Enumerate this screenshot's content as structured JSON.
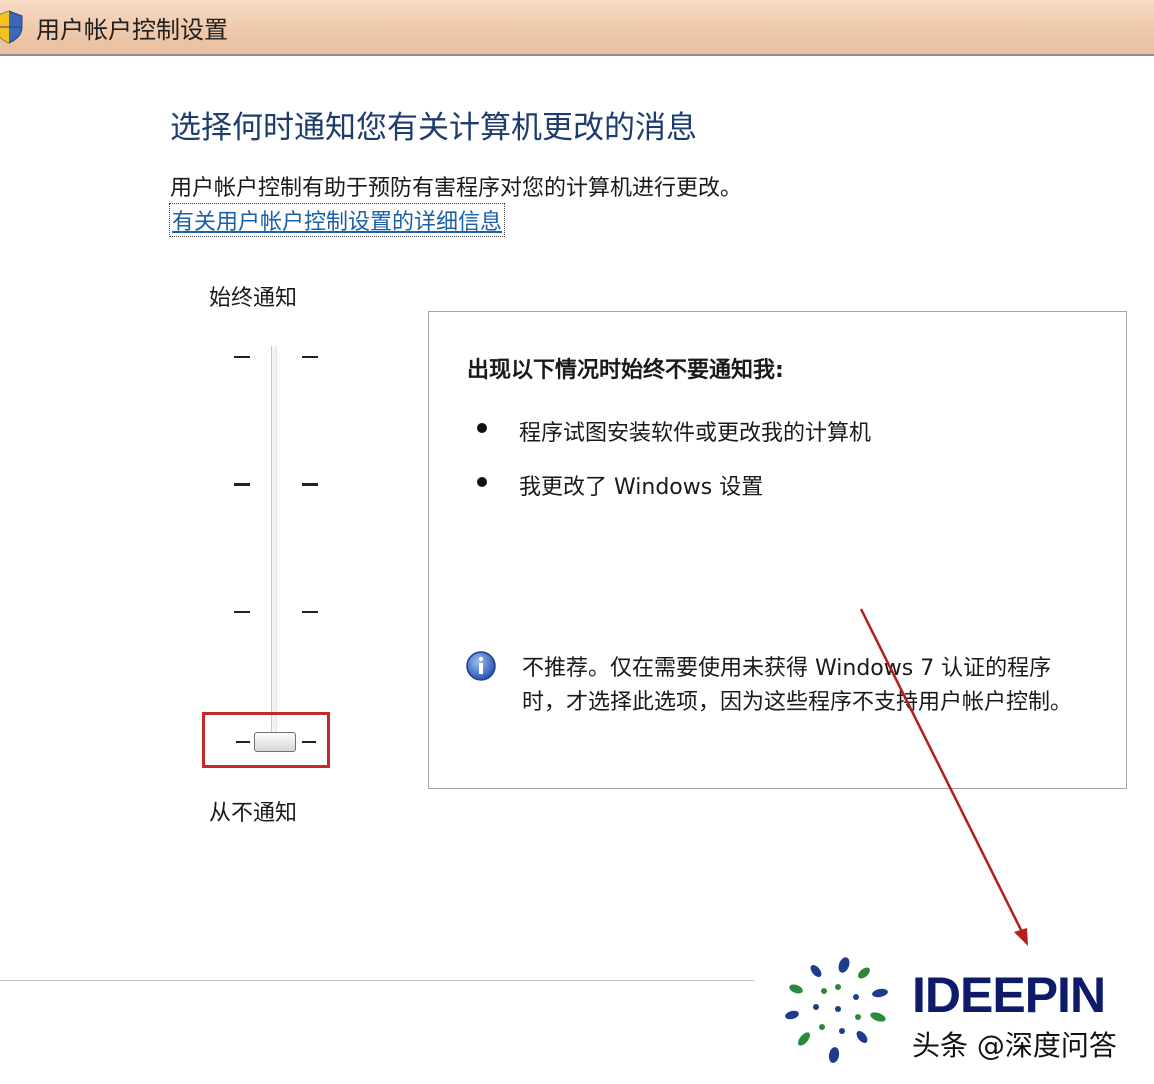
{
  "window": {
    "title": "用户帐户控制设置",
    "icon": "uac-shield-icon"
  },
  "main": {
    "heading": "选择何时通知您有关计算机更改的消息",
    "description": "用户帐户控制有助于预防有害程序对您的计算机进行更改。",
    "help_link": "有关用户帐户控制设置的详细信息"
  },
  "slider": {
    "top_label": "始终通知",
    "bottom_label": "从不通知",
    "levels": 4,
    "selected_level": 1
  },
  "panel": {
    "heading": "出现以下情况时始终不要通知我:",
    "bullets": [
      "程序试图安装软件或更改我的计算机",
      "我更改了 Windows 设置"
    ],
    "info_icon": "info-icon",
    "info_text": "不推荐。仅在需要使用未获得 Windows 7 认证的程序时，才选择此选项，因为这些程序不支持用户帐户控制。"
  },
  "annotation": {
    "highlight_color": "#c62828",
    "arrow_color": "#b71c1c"
  },
  "watermark": {
    "brand": "IDEEPIN",
    "text": "头条 @深度问答"
  },
  "colors": {
    "heading": "#1e3c6e",
    "link": "#1a5fa8",
    "titlebar": "#efc9ab"
  }
}
